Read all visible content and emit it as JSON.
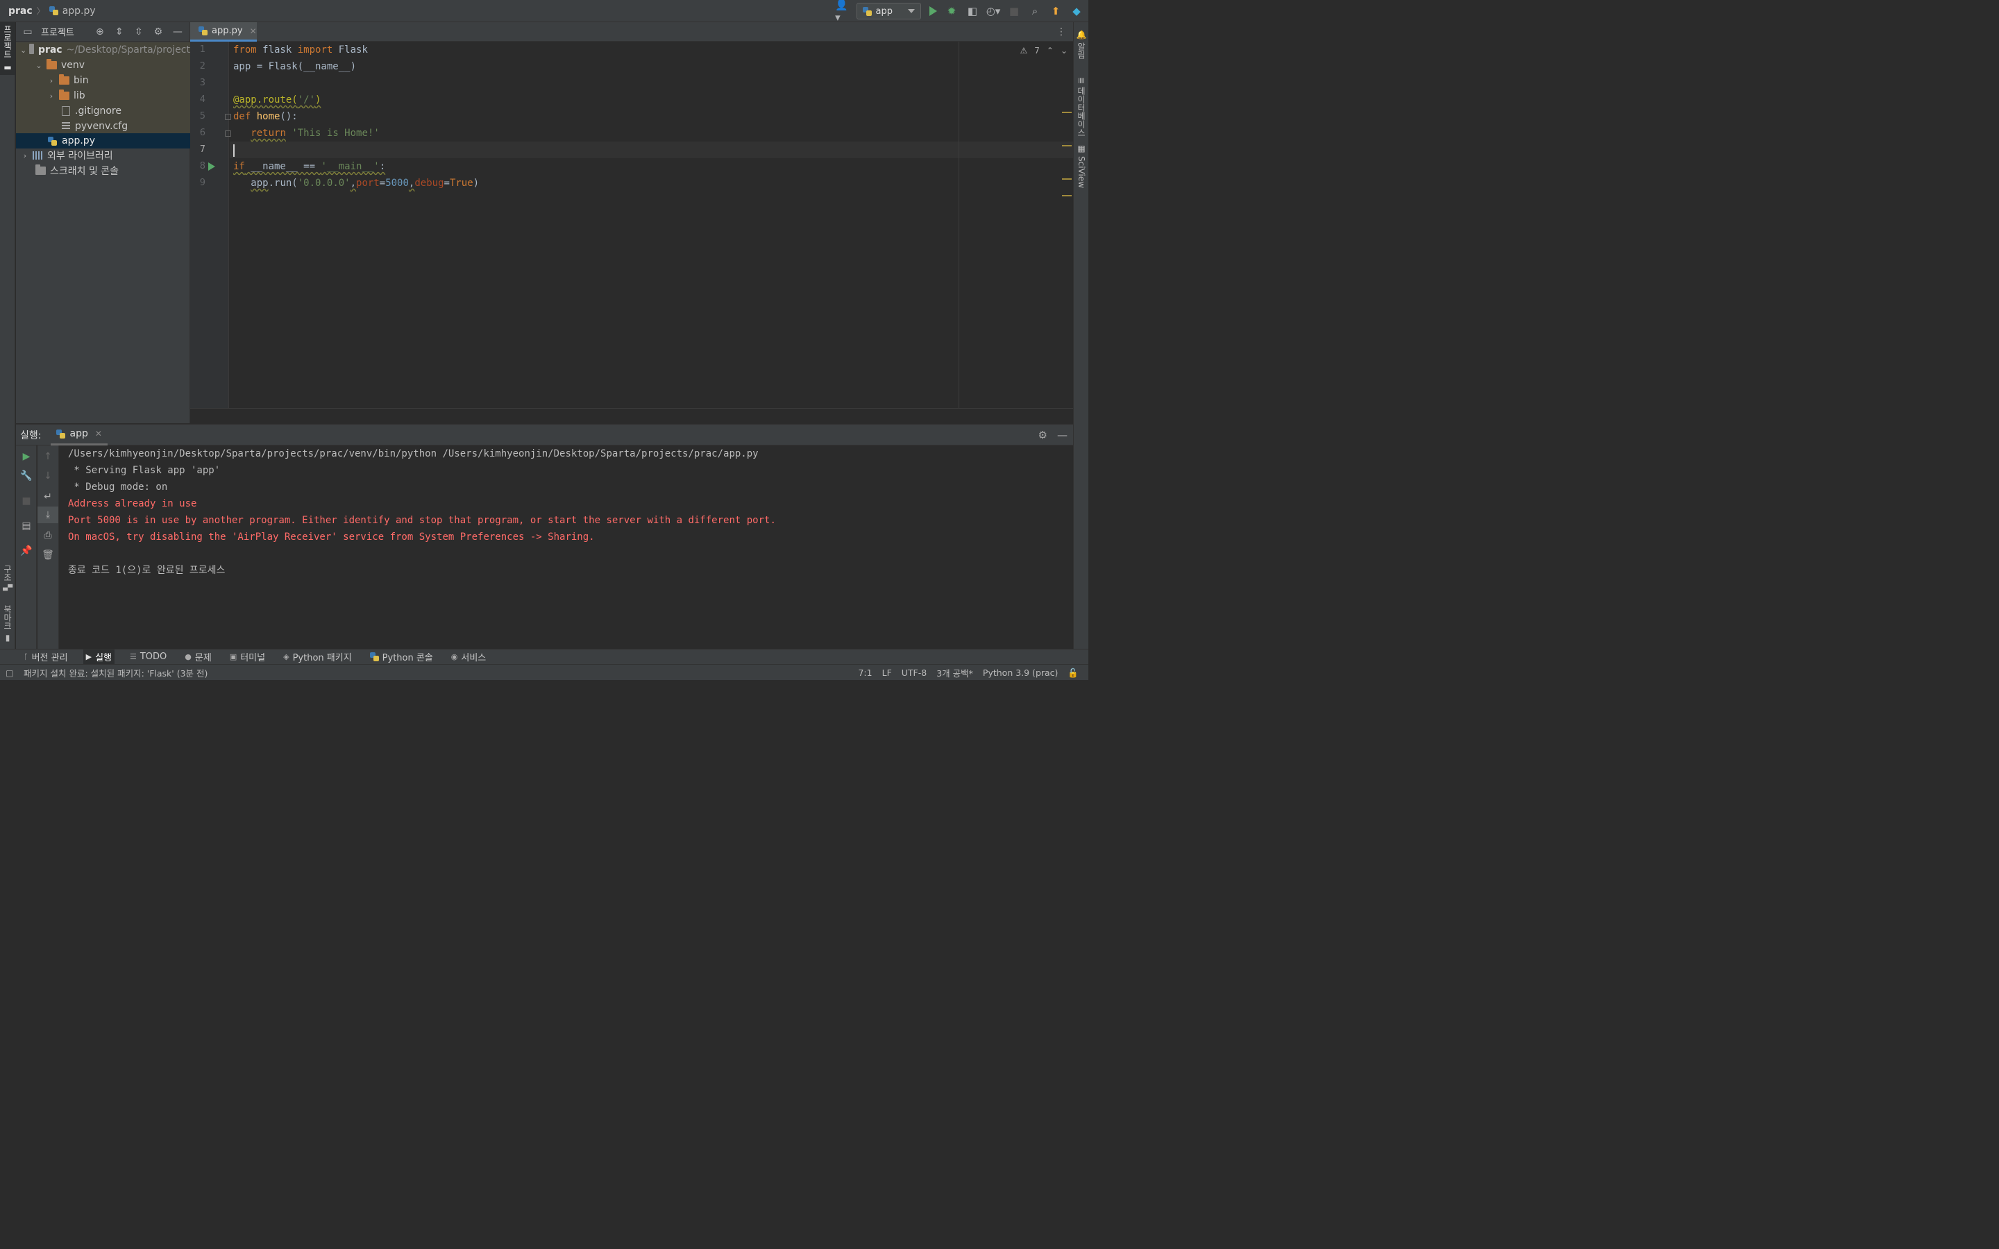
{
  "titlebar": {
    "project": "prac",
    "file": "app.py",
    "run_config": "app"
  },
  "toolwindows": {
    "left_project": "프로젝트",
    "left_structure": "구조",
    "left_bookmarks": "북마크",
    "right_notifications": "알림",
    "right_database": "데이터베이스",
    "right_sciview": "SciView"
  },
  "project_panel": {
    "title": "프로젝트",
    "tree": [
      {
        "label": "prac",
        "extra": "~/Desktop/Sparta/project",
        "type": "root-folder",
        "depth": 0,
        "expanded": true
      },
      {
        "label": "venv",
        "type": "folder",
        "depth": 1,
        "expanded": true
      },
      {
        "label": "bin",
        "type": "folder",
        "depth": 2,
        "expanded": false
      },
      {
        "label": "lib",
        "type": "folder",
        "depth": 2,
        "expanded": false
      },
      {
        "label": ".gitignore",
        "type": "file",
        "depth": 2
      },
      {
        "label": "pyvenv.cfg",
        "type": "config-file",
        "depth": 2
      },
      {
        "label": "app.py",
        "type": "python-file",
        "depth": 1,
        "selected": true
      },
      {
        "label": "외부 라이브러리",
        "type": "library",
        "depth": 0,
        "expanded": false
      },
      {
        "label": "스크래치 및 콘솔",
        "type": "scratch",
        "depth": 0
      }
    ]
  },
  "editor": {
    "tab_label": "app.py",
    "warning_count": "7",
    "line_numbers": [
      "1",
      "2",
      "3",
      "4",
      "5",
      "6",
      "7",
      "8",
      "9"
    ],
    "caret_line": 7
  },
  "run_panel": {
    "label": "실행:",
    "tab_label": "app",
    "console": [
      {
        "text": "/Users/kimhyeonjin/Desktop/Sparta/projects/prac/venv/bin/python /Users/kimhyeonjin/Desktop/Sparta/projects/prac/app.py",
        "kind": "normal"
      },
      {
        "text": " * Serving Flask app 'app'",
        "kind": "normal"
      },
      {
        "text": " * Debug mode: on",
        "kind": "normal"
      },
      {
        "text": "Address already in use",
        "kind": "error"
      },
      {
        "text": "Port 5000 is in use by another program. Either identify and stop that program, or start the server with a different port.",
        "kind": "error"
      },
      {
        "text": "On macOS, try disabling the 'AirPlay Receiver' service from System Preferences -> Sharing.",
        "kind": "error"
      },
      {
        "text": "",
        "kind": "normal"
      },
      {
        "text": "종료 코드 1(으)로 완료된 프로세스",
        "kind": "normal"
      }
    ]
  },
  "bottom_tabs": [
    {
      "label": "버전 관리",
      "icon": "branch-icon"
    },
    {
      "label": "실행",
      "icon": "play-icon",
      "active": true
    },
    {
      "label": "TODO",
      "icon": "list-icon"
    },
    {
      "label": "문제",
      "icon": "problem-icon"
    },
    {
      "label": "터미널",
      "icon": "terminal-icon"
    },
    {
      "label": "Python 패키지",
      "icon": "packages-icon"
    },
    {
      "label": "Python 콘솔",
      "icon": "python-icon"
    },
    {
      "label": "서비스",
      "icon": "services-icon"
    }
  ],
  "statusbar": {
    "message": "패키지 설치 완료: 설치된 패키지: 'Flask' (3분 전)",
    "position": "7:1",
    "line_sep": "LF",
    "encoding": "UTF-8",
    "indent": "3개 공백*",
    "interpreter": "Python 3.9 (prac)"
  },
  "colors": {
    "accent": "#4a88c7",
    "run_green": "#59a869",
    "error_red": "#ff6b68",
    "update_orange": "#f0a73a"
  }
}
